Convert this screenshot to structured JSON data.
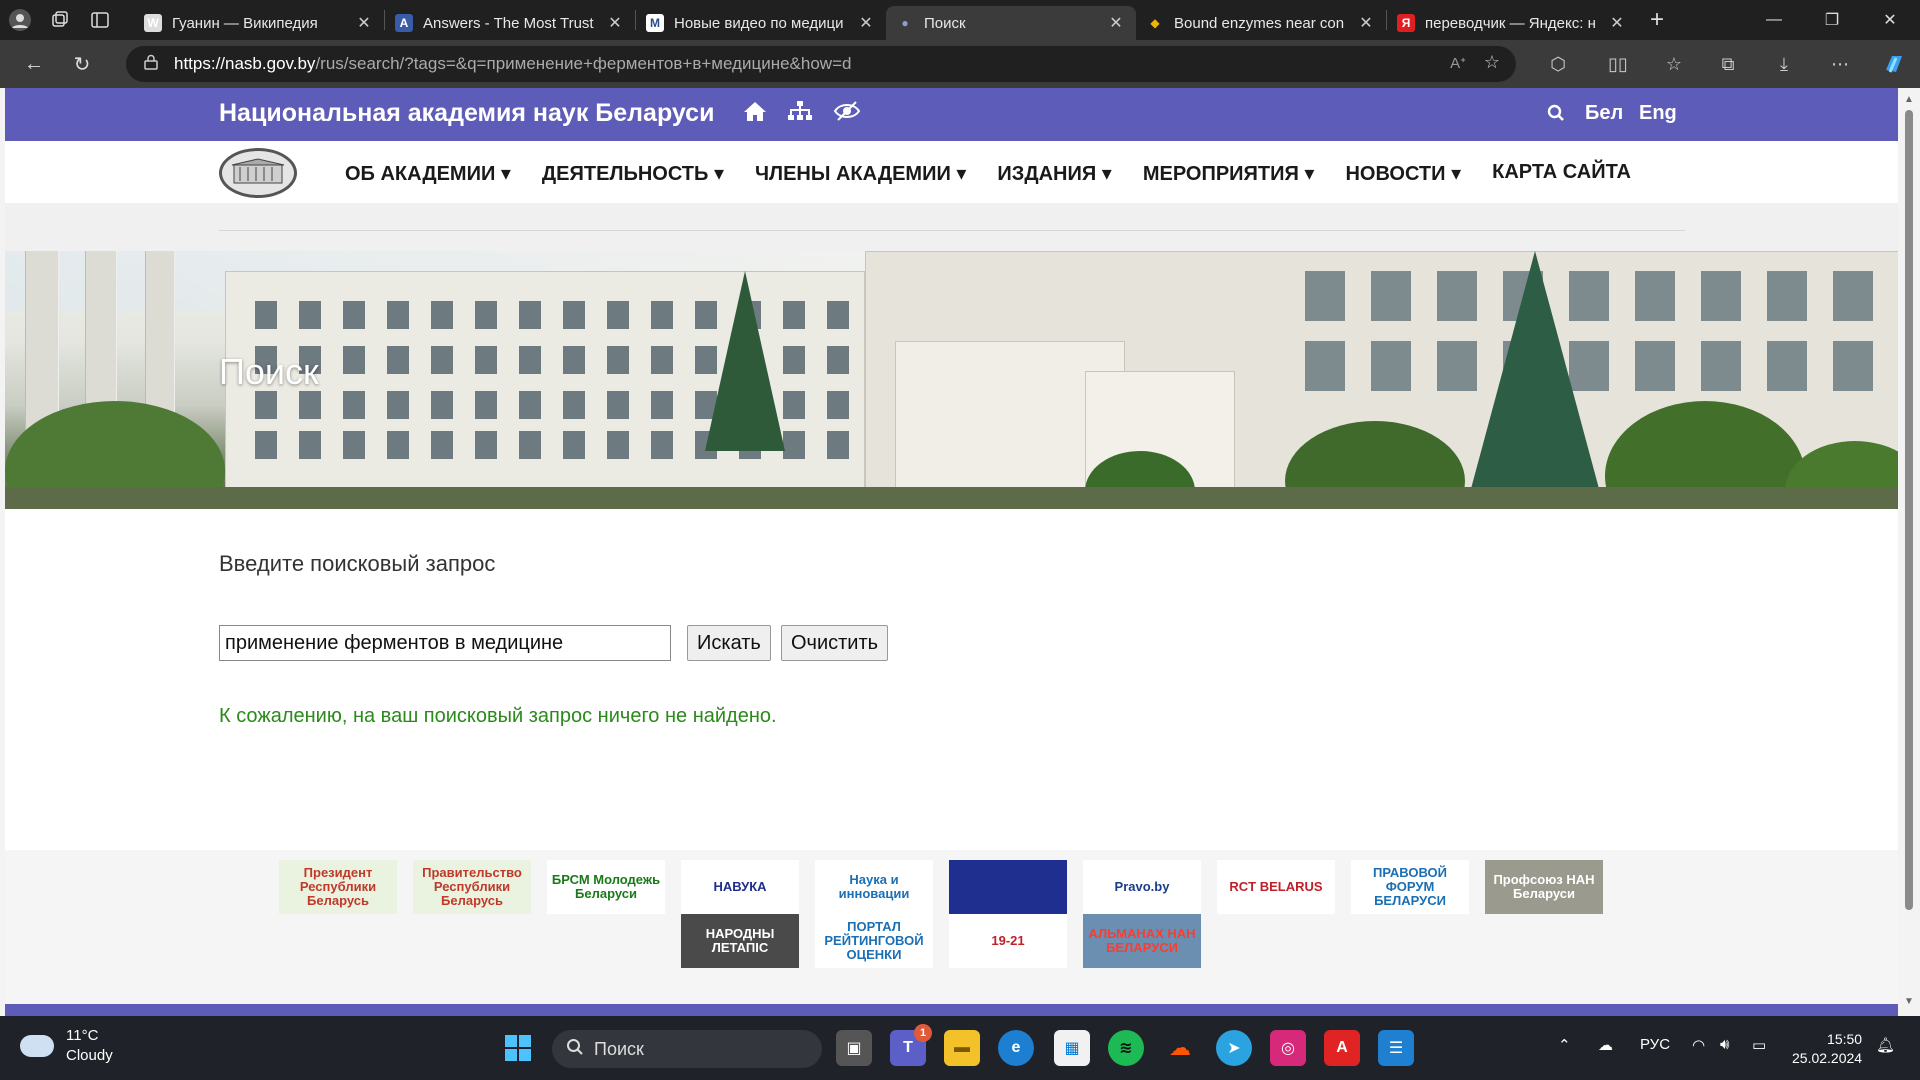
{
  "browser": {
    "tabs": [
      {
        "title": "Гуанин — Википедия",
        "favicon": "W",
        "fav_color": "#ffffff",
        "fav_bg": "#dddddd"
      },
      {
        "title": "Answers - The Most Trust",
        "favicon": "A",
        "fav_color": "#ffffff",
        "fav_bg": "#3a5ba8"
      },
      {
        "title": "Новые видео по медици",
        "favicon": "M",
        "fav_color": "#2a4c8a",
        "fav_bg": "#ffffff"
      },
      {
        "title": "Поиск",
        "favicon": "●",
        "fav_color": "#8aa0c8",
        "fav_bg": "#3b3b3b"
      },
      {
        "title": "Bound enzymes near con",
        "favicon": "◆",
        "fav_color": "#f0b400",
        "fav_bg": "#202020"
      },
      {
        "title": "переводчик — Яндекс: н",
        "favicon": "Я",
        "fav_color": "#ffffff",
        "fav_bg": "#e02020"
      }
    ],
    "active_tab_index": 3,
    "url_host": "https://nasb.gov.by",
    "url_rest": "/rus/search/?tags=&q=применение+ферментов+в+медицине&how=d"
  },
  "site": {
    "brand": "Национальная академия наук Беларуси",
    "lang_be": "Бел",
    "lang_en": "Eng",
    "nav": [
      "ОБ АКАДЕМИИ ▾",
      "ДЕЯТЕЛЬНОСТЬ ▾",
      "ЧЛЕНЫ АКАДЕМИИ ▾",
      "ИЗДАНИЯ ▾",
      "МЕРОПРИЯТИЯ ▾",
      "НОВОСТИ ▾",
      "КАРТА САЙТА"
    ]
  },
  "hero": {
    "title": "Поиск"
  },
  "search": {
    "prompt": "Введите поисковый запрос",
    "query": "применение ферментов в медицине",
    "submit_label": "Искать",
    "clear_label": "Очистить",
    "result_message": "К сожалению, на ваш поисковый запрос ничего не найдено."
  },
  "partners": [
    {
      "label": "Президент Республики Беларусь",
      "bg": "#e9f3df",
      "color": "#c0392b"
    },
    {
      "label": "Правительство Республики Беларусь",
      "bg": "#e9f3df",
      "color": "#c0392b"
    },
    {
      "label": "БРСМ Молодежь Беларуси",
      "bg": "#ffffff",
      "color": "#1a7a1a"
    },
    {
      "label": "НАВУКА",
      "bg": "#ffffff",
      "color": "#1d2f8a"
    },
    {
      "label": "Наука и инновации",
      "bg": "#ffffff",
      "color": "#1b6fb5"
    },
    {
      "label": "",
      "bg": "#1f2f8f",
      "color": "#ffd400"
    },
    {
      "label": "Pravo.by",
      "bg": "#ffffff",
      "color": "#1a3e8a"
    },
    {
      "label": "RCT BELARUS",
      "bg": "#ffffff",
      "color": "#c0202a"
    },
    {
      "label": "ПРАВОВОЙ ФОРУМ БЕЛАРУСИ",
      "bg": "#ffffff",
      "color": "#1b6fb5"
    },
    {
      "label": "Профсоюз НАН Беларуси",
      "bg": "#9a9a8e",
      "color": "#ffffff"
    },
    {
      "label": "НАРОДНЫ ЛЕТАПІС",
      "bg": "#4a4a4a",
      "color": "#ffffff"
    },
    {
      "label": "ПОРТАЛ РЕЙТИНГОВОЙ ОЦЕНКИ",
      "bg": "#ffffff",
      "color": "#1b6fb5"
    },
    {
      "label": "19-21",
      "bg": "#ffffff",
      "color": "#c0202a"
    },
    {
      "label": "АЛЬМАНАХ НАН БЕЛАРУСИ",
      "bg": "#6b8fb0",
      "color": "#ff3b30"
    }
  ],
  "taskbar": {
    "temperature": "11°C",
    "condition": "Cloudy",
    "search_label": "Поиск",
    "lang": "РУС",
    "time": "15:50",
    "date": "25.02.2024",
    "teams_badge": "1"
  },
  "colors": {
    "brand_purple": "#5d5cb8",
    "result_green": "#2a8a1a"
  }
}
